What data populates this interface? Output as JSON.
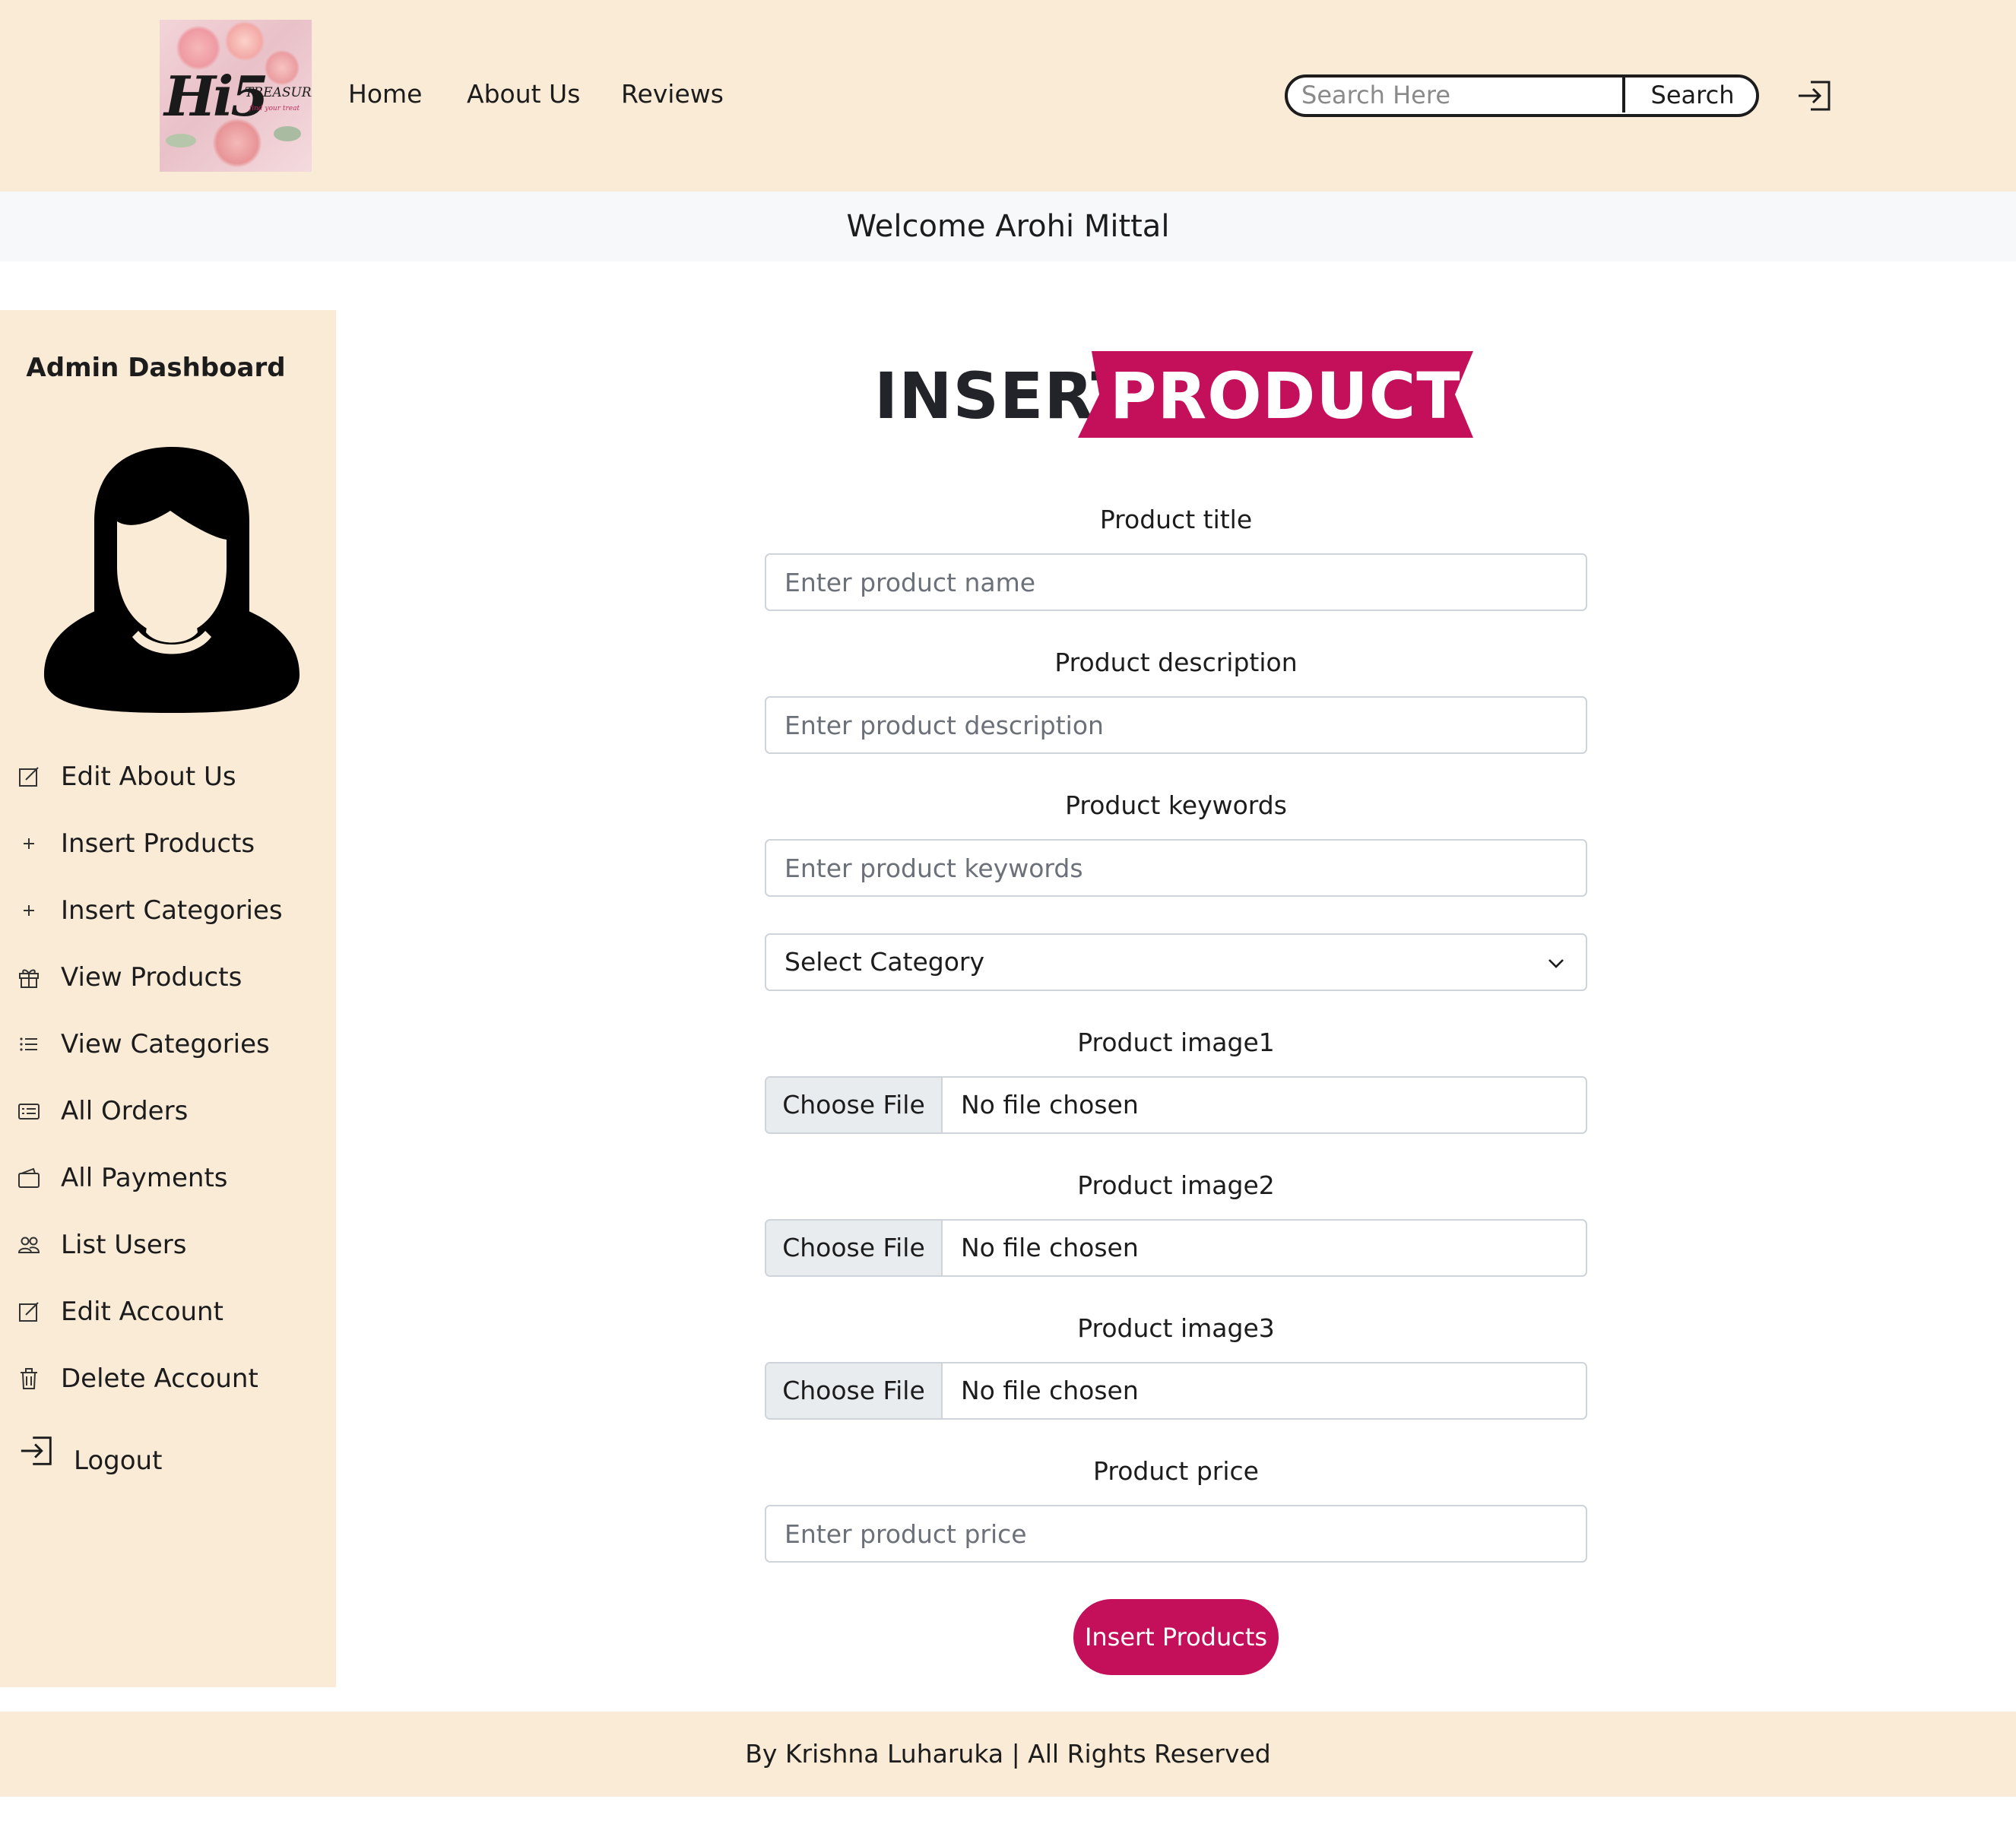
{
  "header": {
    "logo": {
      "main": "Hi5",
      "sub": "TREASURES",
      "tagline": "find your treat"
    },
    "nav": [
      "Home",
      "About Us",
      "Reviews"
    ],
    "search": {
      "placeholder": "Search Here",
      "value": "",
      "button_label": "Search"
    },
    "login_icon": "login-arrow-icon"
  },
  "welcome": "Welcome Arohi Mittal",
  "sidebar": {
    "title": "Admin Dashboard",
    "avatar_icon": "female-user-avatar-icon",
    "items": [
      {
        "label": "Edit About Us",
        "icon": "edit-square-icon"
      },
      {
        "label": "Insert Products",
        "icon": "plus-icon"
      },
      {
        "label": "Insert Categories",
        "icon": "plus-icon"
      },
      {
        "label": "View Products",
        "icon": "gift-icon"
      },
      {
        "label": "View Categories",
        "icon": "list-icon"
      },
      {
        "label": "All Orders",
        "icon": "card-list-icon"
      },
      {
        "label": "All Payments",
        "icon": "wallet-icon"
      },
      {
        "label": "List Users",
        "icon": "people-icon"
      },
      {
        "label": "Edit Account",
        "icon": "edit-square-icon"
      },
      {
        "label": "Delete Account",
        "icon": "trash-icon"
      },
      {
        "label": "Logout",
        "icon": "logout-arrow-icon"
      }
    ]
  },
  "form": {
    "heading_left": "INSERT",
    "heading_right": "PRODUCTS",
    "accent_color": "#c4105a",
    "title": {
      "label": "Product title",
      "placeholder": "Enter product name",
      "value": ""
    },
    "description": {
      "label": "Product description",
      "placeholder": "Enter product description",
      "value": ""
    },
    "keywords": {
      "label": "Product keywords",
      "placeholder": "Enter product keywords",
      "value": ""
    },
    "category": {
      "selected": "Select Category"
    },
    "image1": {
      "label": "Product image1",
      "button": "Choose File",
      "status": "No file chosen"
    },
    "image2": {
      "label": "Product image2",
      "button": "Choose File",
      "status": "No file chosen"
    },
    "image3": {
      "label": "Product image3",
      "button": "Choose File",
      "status": "No file chosen"
    },
    "price": {
      "label": "Product price",
      "placeholder": "Enter product price",
      "value": ""
    },
    "submit_label": "Insert Products"
  },
  "footer": {
    "text": "By Krishna Luharuka | All Rights Reserved"
  },
  "colors": {
    "header_bg": "#faebd7",
    "welcome_bg": "#f7f8fa",
    "accent": "#c4105a"
  }
}
